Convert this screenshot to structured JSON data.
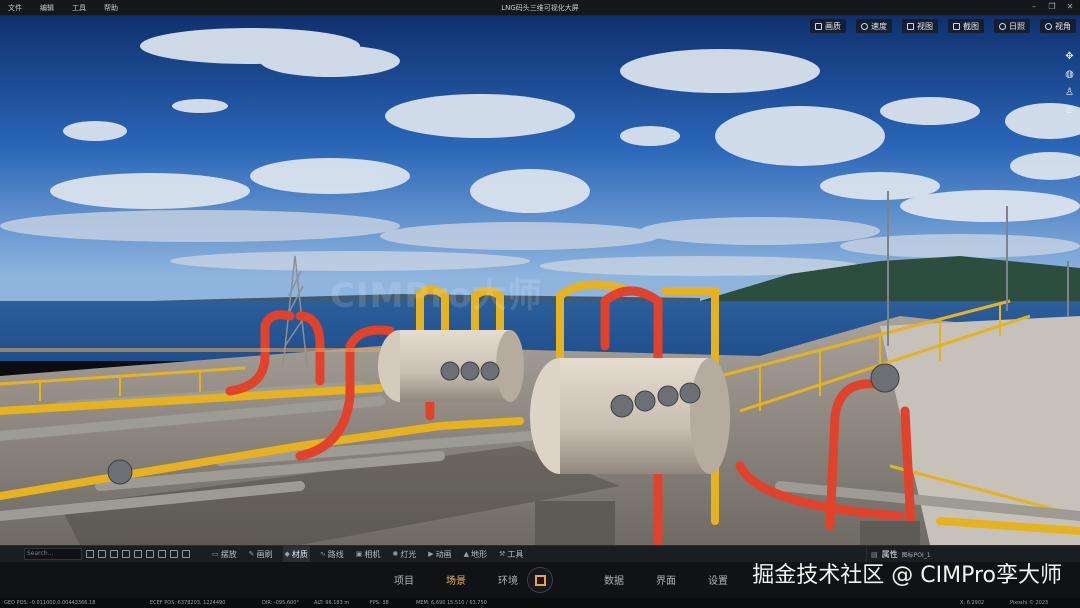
{
  "menu": {
    "items": [
      "文件",
      "编辑",
      "工具",
      "帮助"
    ]
  },
  "window": {
    "title": "LNG码头三维可视化大屏"
  },
  "view_toolbar": {
    "buttons": [
      {
        "icon": "display-icon",
        "label": "画质"
      },
      {
        "icon": "speed-icon",
        "label": "速度"
      },
      {
        "icon": "view-icon",
        "label": "视图"
      },
      {
        "icon": "screenshot-icon",
        "label": "截图"
      },
      {
        "icon": "sun-icon",
        "label": "日照"
      },
      {
        "icon": "eye-icon",
        "label": "视角"
      }
    ]
  },
  "side_tools": [
    "move-icon",
    "globe-icon",
    "person-icon",
    "layers-icon"
  ],
  "watermark": "CIMPro大师",
  "toolstrip": {
    "search_placeholder": "Search...",
    "tabs": [
      {
        "label": "摆放",
        "active": false
      },
      {
        "label": "画刷",
        "active": false
      },
      {
        "label": "材质",
        "active": true
      },
      {
        "label": "路线",
        "active": false
      },
      {
        "label": "相机",
        "active": false
      },
      {
        "label": "灯光",
        "active": false
      },
      {
        "label": "动画",
        "active": false
      },
      {
        "label": "地形",
        "active": false
      },
      {
        "label": "工具",
        "active": false
      }
    ],
    "properties": {
      "label": "属性",
      "sub": "图标POI_1"
    }
  },
  "bottom_nav": {
    "items_left": [
      "项目",
      "场景",
      "环境"
    ],
    "items_right": [
      "数据",
      "界面",
      "设置"
    ],
    "active": "场景",
    "credit": "掘金技术社区 @ CIMPro孪大师"
  },
  "status": {
    "geo_pos": "GEO POS: -0.011000,0.00443366.18",
    "ecef_pos": "ECEF POS: 6378203, 1224490",
    "dir": "DIR: -095.600°",
    "alt": "ALT: 96.183 m",
    "fps": "FPS: 38",
    "mem": "MEM: 6.690 15.510 / 63.750",
    "coord": "X: 6.2902",
    "brand": "Pixoshi © 2023"
  },
  "colors": {
    "accent": "#f0b54a",
    "sky_top": "#16418a",
    "pipe_red": "#e0422b",
    "pipe_yellow": "#e6b21f"
  }
}
